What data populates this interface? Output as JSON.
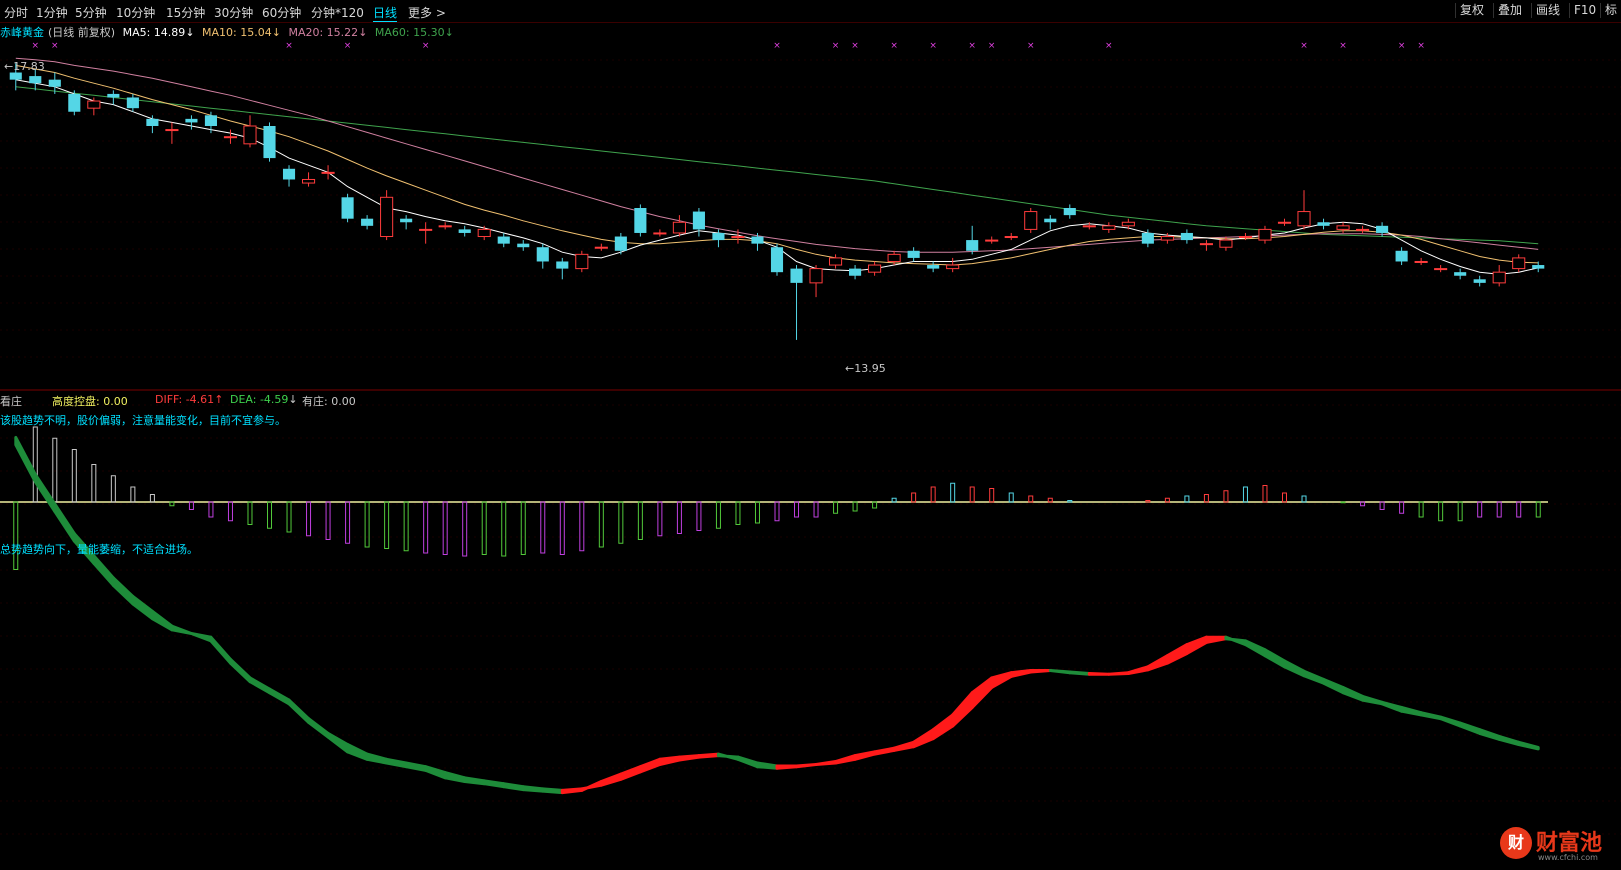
{
  "toolbar": {
    "periods": [
      "分时",
      "1分钟",
      "5分钟",
      "10分钟",
      "15分钟",
      "30分钟",
      "60分钟",
      "分钟*120",
      "日线",
      "更多 >"
    ],
    "active_period": "日线",
    "right_buttons": [
      "复权",
      "叠加",
      "画线",
      "F10",
      "标"
    ]
  },
  "header": {
    "stock_name": "赤峰黄金",
    "mode": "(日线 前复权)",
    "ma5": "MA5: 14.89",
    "ma10": "MA10: 15.04",
    "ma20": "MA20: 15.22",
    "ma60": "MA60: 15.30",
    "ma5_arrow": "↓",
    "ma10_arrow": "↓",
    "ma20_arrow": "↓",
    "ma60_arrow": "↓"
  },
  "price_labels": {
    "high": "17.83",
    "low": "13.95"
  },
  "indicator": {
    "name": "看庄",
    "control_label": "高度控盘: 0.00",
    "diff": "DIFF: -4.61",
    "diff_arrow": "↑",
    "dea": "DEA: -4.59",
    "dea_arrow": "↓",
    "dealer": "有庄: 0.00",
    "comment1": "该股趋势不明，股价偏弱，注意量能变化，目前不宜参与。",
    "comment2": "总势趋势向下，量能萎缩，不适合进场。"
  },
  "watermark": {
    "brand": "财富池",
    "url": "www.cfchi.com",
    "logo_char": "财"
  },
  "colors": {
    "up": "#ff3c3c",
    "down": "#54d6e6",
    "ma5": "#ffffff",
    "ma10": "#f0c070",
    "ma20": "#d080a0",
    "ma60": "#3fa34d",
    "diff_up": "#ff1a1a",
    "diff_down": "#1e8c3a",
    "accent": "#00e0ff",
    "hist_a": "#52c93a",
    "hist_b": "#c040e0"
  },
  "chart_data": {
    "type": "candlestick",
    "price_ylim": [
      13.5,
      18.1
    ],
    "candles": [
      [
        17.7,
        17.6,
        17.83,
        17.45
      ],
      [
        17.65,
        17.55,
        17.75,
        17.45
      ],
      [
        17.6,
        17.5,
        17.7,
        17.4
      ],
      [
        17.4,
        17.15,
        17.45,
        17.1
      ],
      [
        17.2,
        17.3,
        17.35,
        17.1
      ],
      [
        17.4,
        17.35,
        17.45,
        17.25
      ],
      [
        17.35,
        17.2,
        17.4,
        17.15
      ],
      [
        17.05,
        16.95,
        17.1,
        16.85
      ],
      [
        16.9,
        16.9,
        17.0,
        16.7
      ],
      [
        17.05,
        17.0,
        17.1,
        16.9
      ],
      [
        17.1,
        16.95,
        17.15,
        16.85
      ],
      [
        16.8,
        16.8,
        16.9,
        16.7
      ],
      [
        16.7,
        16.95,
        17.1,
        16.65
      ],
      [
        16.95,
        16.5,
        17.0,
        16.45
      ],
      [
        16.35,
        16.2,
        16.4,
        16.1
      ],
      [
        16.15,
        16.2,
        16.3,
        16.1
      ],
      [
        16.3,
        16.3,
        16.4,
        16.2
      ],
      [
        15.95,
        15.65,
        16.0,
        15.6
      ],
      [
        15.65,
        15.55,
        15.7,
        15.5
      ],
      [
        15.4,
        15.95,
        16.05,
        15.35
      ],
      [
        15.65,
        15.6,
        15.7,
        15.5
      ],
      [
        15.5,
        15.5,
        15.6,
        15.3
      ],
      [
        15.55,
        15.55,
        15.6,
        15.5
      ],
      [
        15.5,
        15.45,
        15.55,
        15.4
      ],
      [
        15.4,
        15.5,
        15.55,
        15.35
      ],
      [
        15.4,
        15.3,
        15.45,
        15.25
      ],
      [
        15.3,
        15.25,
        15.35,
        15.2
      ],
      [
        15.25,
        15.05,
        15.3,
        14.95
      ],
      [
        15.05,
        14.95,
        15.1,
        14.8
      ],
      [
        14.95,
        15.15,
        15.2,
        14.9
      ],
      [
        15.25,
        15.25,
        15.3,
        15.2
      ],
      [
        15.4,
        15.2,
        15.45,
        15.15
      ],
      [
        15.8,
        15.45,
        15.85,
        15.4
      ],
      [
        15.45,
        15.45,
        15.5,
        15.4
      ],
      [
        15.45,
        15.6,
        15.7,
        15.4
      ],
      [
        15.75,
        15.5,
        15.8,
        15.4
      ],
      [
        15.45,
        15.35,
        15.5,
        15.25
      ],
      [
        15.4,
        15.4,
        15.5,
        15.3
      ],
      [
        15.4,
        15.3,
        15.45,
        15.2
      ],
      [
        15.25,
        14.9,
        15.3,
        14.85
      ],
      [
        14.95,
        14.75,
        15.0,
        13.95
      ],
      [
        14.75,
        14.95,
        15.0,
        14.55
      ],
      [
        15.0,
        15.1,
        15.15,
        14.95
      ],
      [
        14.95,
        14.85,
        15.0,
        14.8
      ],
      [
        14.9,
        15.0,
        15.05,
        14.85
      ],
      [
        15.05,
        15.15,
        15.2,
        15.0
      ],
      [
        15.2,
        15.1,
        15.25,
        15.05
      ],
      [
        15.0,
        14.95,
        15.05,
        14.9
      ],
      [
        14.95,
        15.0,
        15.1,
        14.9
      ],
      [
        15.35,
        15.2,
        15.55,
        15.15
      ],
      [
        15.35,
        15.35,
        15.4,
        15.3
      ],
      [
        15.4,
        15.4,
        15.45,
        15.35
      ],
      [
        15.5,
        15.75,
        15.8,
        15.45
      ],
      [
        15.65,
        15.6,
        15.7,
        15.5
      ],
      [
        15.8,
        15.7,
        15.85,
        15.65
      ],
      [
        15.55,
        15.55,
        15.6,
        15.5
      ],
      [
        15.5,
        15.55,
        15.6,
        15.45
      ],
      [
        15.55,
        15.6,
        15.65,
        15.5
      ],
      [
        15.45,
        15.3,
        15.5,
        15.25
      ],
      [
        15.35,
        15.4,
        15.45,
        15.3
      ],
      [
        15.45,
        15.35,
        15.5,
        15.3
      ],
      [
        15.3,
        15.3,
        15.35,
        15.2
      ],
      [
        15.25,
        15.35,
        15.4,
        15.2
      ],
      [
        15.4,
        15.4,
        15.45,
        15.35
      ],
      [
        15.35,
        15.5,
        15.55,
        15.3
      ],
      [
        15.6,
        15.6,
        15.65,
        15.55
      ],
      [
        15.55,
        15.75,
        16.05,
        15.5
      ],
      [
        15.6,
        15.55,
        15.65,
        15.5
      ],
      [
        15.5,
        15.55,
        15.6,
        15.45
      ],
      [
        15.5,
        15.5,
        15.55,
        15.45
      ],
      [
        15.55,
        15.45,
        15.6,
        15.4
      ],
      [
        15.2,
        15.05,
        15.25,
        15.0
      ],
      [
        15.05,
        15.05,
        15.1,
        15.0
      ],
      [
        14.95,
        14.95,
        15.0,
        14.9
      ],
      [
        14.9,
        14.85,
        14.95,
        14.8
      ],
      [
        14.8,
        14.75,
        14.85,
        14.7
      ],
      [
        14.75,
        14.9,
        15.0,
        14.7
      ],
      [
        14.95,
        15.1,
        15.15,
        14.9
      ],
      [
        15.0,
        14.95,
        15.05,
        14.9
      ]
    ],
    "ma5": [
      17.6,
      17.55,
      17.5,
      17.4,
      17.3,
      17.25,
      17.15,
      17.05,
      17.0,
      16.95,
      16.9,
      16.85,
      16.78,
      16.65,
      16.5,
      16.4,
      16.3,
      16.1,
      15.95,
      15.8,
      15.75,
      15.68,
      15.62,
      15.58,
      15.52,
      15.45,
      15.38,
      15.3,
      15.18,
      15.12,
      15.1,
      15.18,
      15.28,
      15.35,
      15.42,
      15.48,
      15.45,
      15.42,
      15.35,
      15.25,
      15.05,
      14.95,
      14.93,
      14.92,
      14.95,
      15.0,
      15.05,
      15.05,
      15.05,
      15.08,
      15.15,
      15.22,
      15.35,
      15.48,
      15.55,
      15.58,
      15.55,
      15.52,
      15.45,
      15.42,
      15.4,
      15.38,
      15.35,
      15.38,
      15.42,
      15.45,
      15.52,
      15.58,
      15.6,
      15.58,
      15.5,
      15.35,
      15.2,
      15.08,
      14.98,
      14.9,
      14.87,
      14.9,
      14.96
    ],
    "ma10": [
      17.8,
      17.75,
      17.7,
      17.62,
      17.55,
      17.48,
      17.4,
      17.32,
      17.25,
      17.18,
      17.1,
      17.02,
      16.95,
      16.88,
      16.8,
      16.7,
      16.6,
      16.48,
      16.36,
      16.25,
      16.15,
      16.05,
      15.95,
      15.85,
      15.77,
      15.7,
      15.62,
      15.55,
      15.48,
      15.42,
      15.36,
      15.32,
      15.3,
      15.3,
      15.32,
      15.34,
      15.36,
      15.36,
      15.34,
      15.3,
      15.22,
      15.15,
      15.1,
      15.07,
      15.05,
      15.03,
      15.02,
      15.01,
      15.0,
      15.02,
      15.06,
      15.1,
      15.16,
      15.22,
      15.28,
      15.33,
      15.36,
      15.38,
      15.4,
      15.4,
      15.39,
      15.38,
      15.37,
      15.37,
      15.38,
      15.4,
      15.43,
      15.46,
      15.48,
      15.48,
      15.46,
      15.42,
      15.36,
      15.28,
      15.2,
      15.12,
      15.07,
      15.04,
      15.03
    ],
    "ma20": [
      17.9,
      17.88,
      17.85,
      17.8,
      17.76,
      17.72,
      17.67,
      17.62,
      17.56,
      17.5,
      17.44,
      17.38,
      17.31,
      17.24,
      17.17,
      17.1,
      17.02,
      16.94,
      16.86,
      16.78,
      16.7,
      16.62,
      16.54,
      16.46,
      16.38,
      16.3,
      16.22,
      16.14,
      16.06,
      15.98,
      15.9,
      15.82,
      15.75,
      15.68,
      15.62,
      15.56,
      15.51,
      15.46,
      15.41,
      15.37,
      15.33,
      15.29,
      15.26,
      15.23,
      15.21,
      15.19,
      15.18,
      15.18,
      15.18,
      15.19,
      15.2,
      15.21,
      15.23,
      15.25,
      15.27,
      15.29,
      15.31,
      15.33,
      15.35,
      15.36,
      15.37,
      15.38,
      15.39,
      15.4,
      15.41,
      15.42,
      15.43,
      15.44,
      15.44,
      15.44,
      15.43,
      15.42,
      15.4,
      15.37,
      15.34,
      15.31,
      15.28,
      15.25,
      15.22
    ],
    "ma60": [
      17.5,
      17.47,
      17.44,
      17.41,
      17.38,
      17.35,
      17.32,
      17.29,
      17.26,
      17.23,
      17.2,
      17.17,
      17.14,
      17.11,
      17.08,
      17.05,
      17.02,
      16.99,
      16.96,
      16.93,
      16.9,
      16.87,
      16.84,
      16.81,
      16.78,
      16.75,
      16.72,
      16.69,
      16.66,
      16.63,
      16.6,
      16.57,
      16.54,
      16.51,
      16.48,
      16.45,
      16.42,
      16.39,
      16.36,
      16.33,
      16.3,
      16.27,
      16.24,
      16.21,
      16.18,
      16.14,
      16.1,
      16.06,
      16.02,
      15.98,
      15.94,
      15.9,
      15.86,
      15.82,
      15.78,
      15.74,
      15.7,
      15.67,
      15.64,
      15.61,
      15.58,
      15.55,
      15.53,
      15.51,
      15.49,
      15.47,
      15.45,
      15.43,
      15.42,
      15.41,
      15.4,
      15.39,
      15.38,
      15.37,
      15.36,
      15.35,
      15.34,
      15.32,
      15.3
    ],
    "macd_hist": [
      -0.9,
      1.0,
      0.85,
      0.7,
      0.5,
      0.35,
      0.2,
      0.1,
      -0.05,
      -0.1,
      -0.2,
      -0.25,
      -0.3,
      -0.35,
      -0.4,
      -0.45,
      -0.5,
      -0.55,
      -0.6,
      -0.62,
      -0.65,
      -0.68,
      -0.7,
      -0.72,
      -0.7,
      -0.72,
      -0.7,
      -0.68,
      -0.7,
      -0.65,
      -0.6,
      -0.55,
      -0.5,
      -0.45,
      -0.42,
      -0.38,
      -0.35,
      -0.3,
      -0.28,
      -0.25,
      -0.2,
      -0.2,
      -0.15,
      -0.12,
      -0.08,
      0.05,
      0.12,
      0.2,
      0.25,
      0.2,
      0.18,
      0.12,
      0.08,
      0.05,
      0.02,
      0,
      0,
      0,
      0.02,
      0.05,
      0.08,
      0.1,
      0.15,
      0.2,
      0.22,
      0.12,
      0.08,
      0,
      -0.01,
      -0.05,
      -0.1,
      -0.15,
      -0.2,
      -0.25,
      -0.25,
      -0.2,
      -0.2,
      -0.2,
      -0.2
    ],
    "diff_line": [
      -0.5,
      -1.0,
      -1.4,
      -1.8,
      -2.1,
      -2.4,
      -2.65,
      -2.85,
      -3.0,
      -3.05,
      -3.15,
      -3.45,
      -3.7,
      -3.85,
      -4.0,
      -4.25,
      -4.45,
      -4.65,
      -4.75,
      -4.8,
      -4.85,
      -4.9,
      -5.0,
      -5.05,
      -5.08,
      -5.12,
      -5.16,
      -5.18,
      -5.2,
      -5.17,
      -5.05,
      -4.95,
      -4.85,
      -4.75,
      -4.72,
      -4.7,
      -4.68,
      -4.75,
      -4.85,
      -4.87,
      -4.85,
      -4.82,
      -4.78,
      -4.7,
      -4.65,
      -4.6,
      -4.52,
      -4.35,
      -4.15,
      -3.85,
      -3.65,
      -3.58,
      -3.55,
      -3.55,
      -3.58,
      -3.6,
      -3.6,
      -3.58,
      -3.5,
      -3.35,
      -3.2,
      -3.1,
      -3.1,
      -3.2,
      -3.35,
      -3.5,
      -3.62,
      -3.72,
      -3.85,
      -3.95,
      -4.0,
      -4.1,
      -4.15,
      -4.2,
      -4.3,
      -4.4,
      -4.48,
      -4.55,
      -4.61
    ],
    "dea_line": [
      -0.4,
      -0.9,
      -1.3,
      -1.7,
      -2.0,
      -2.3,
      -2.55,
      -2.75,
      -2.95,
      -3.05,
      -3.1,
      -3.4,
      -3.65,
      -3.8,
      -3.95,
      -4.2,
      -4.4,
      -4.55,
      -4.68,
      -4.75,
      -4.8,
      -4.85,
      -4.93,
      -5.0,
      -5.04,
      -5.08,
      -5.12,
      -5.15,
      -5.17,
      -5.15,
      -5.1,
      -5.02,
      -4.92,
      -4.82,
      -4.76,
      -4.72,
      -4.7,
      -4.72,
      -4.8,
      -4.84,
      -4.84,
      -4.82,
      -4.8,
      -4.75,
      -4.68,
      -4.63,
      -4.58,
      -4.47,
      -4.3,
      -4.05,
      -3.78,
      -3.63,
      -3.57,
      -3.55,
      -3.57,
      -3.59,
      -3.6,
      -3.59,
      -3.54,
      -3.45,
      -3.32,
      -3.17,
      -3.12,
      -3.15,
      -3.27,
      -3.42,
      -3.56,
      -3.67,
      -3.78,
      -3.9,
      -3.98,
      -4.05,
      -4.12,
      -4.18,
      -4.26,
      -4.35,
      -4.44,
      -4.52,
      -4.59
    ]
  }
}
